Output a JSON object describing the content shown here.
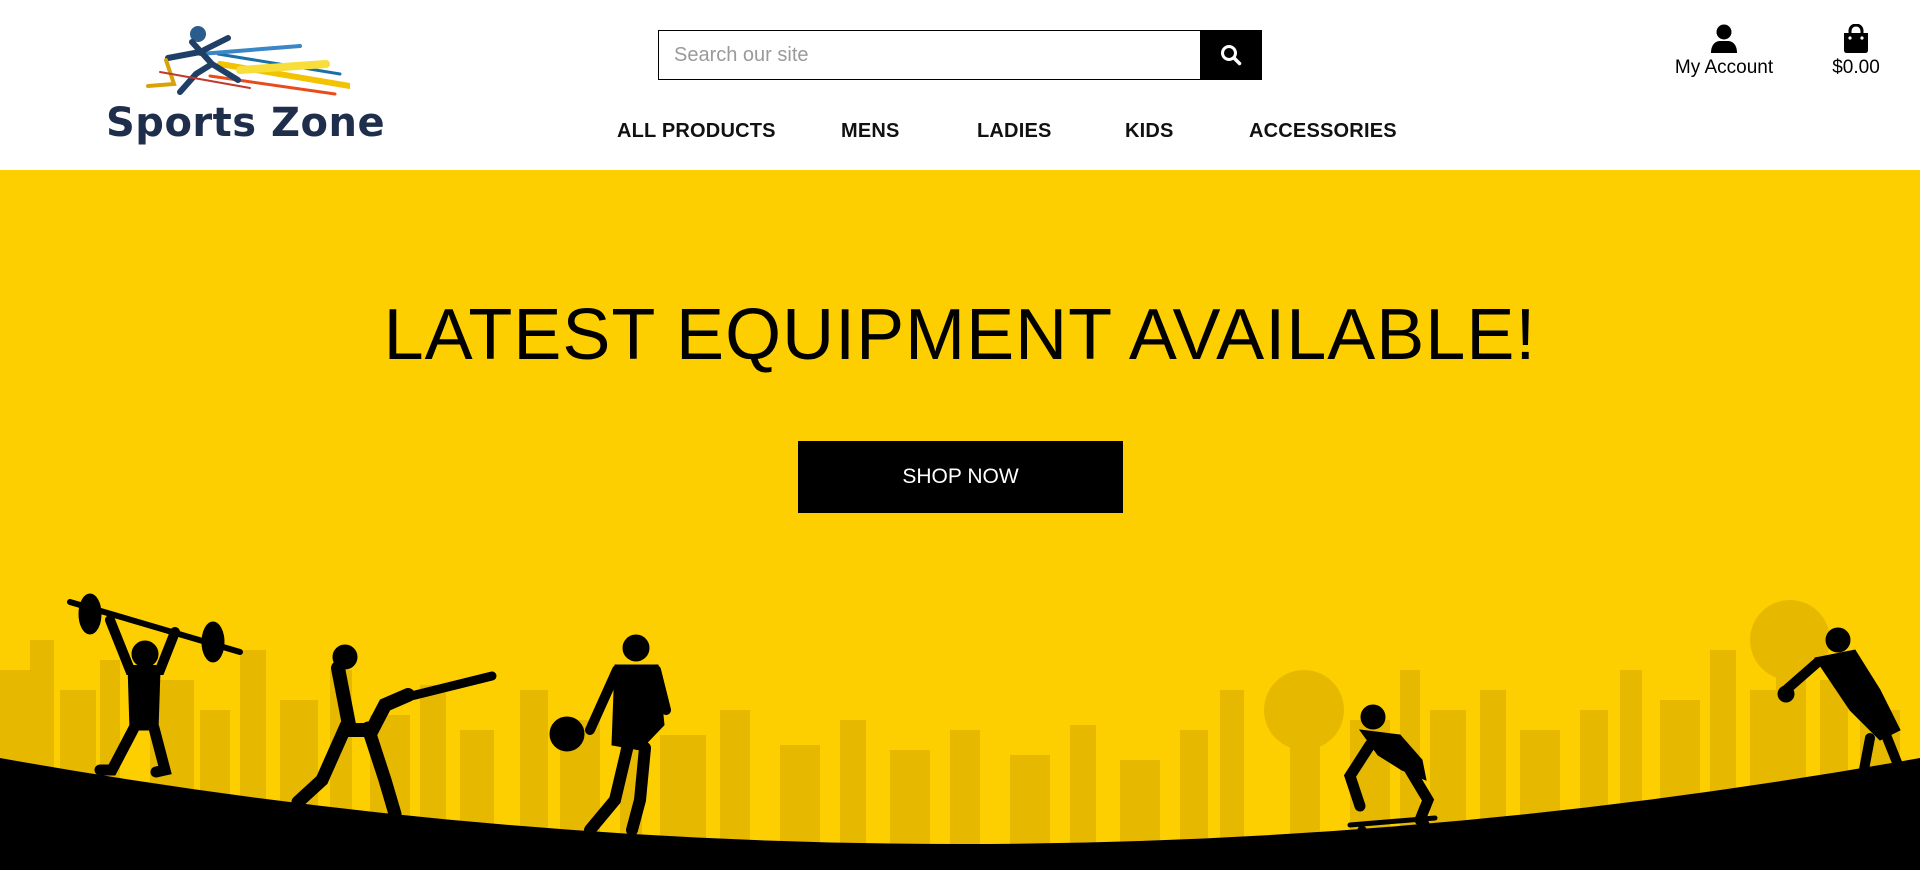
{
  "brand": {
    "name": "Sports Zone",
    "colors": {
      "accent": "#fdcf00",
      "text": "#000000",
      "logo_text": "#1f2e4a"
    }
  },
  "search": {
    "placeholder": "Search our site",
    "value": "",
    "button_icon": "search-icon"
  },
  "account": {
    "label": "My Account",
    "icon": "user-icon"
  },
  "bag": {
    "total": "$0.00",
    "icon": "shopping-bag-icon"
  },
  "nav": {
    "items": [
      {
        "label": "ALL PRODUCTS"
      },
      {
        "label": "MENS"
      },
      {
        "label": "LADIES"
      },
      {
        "label": "KIDS"
      },
      {
        "label": "ACCESSORIES"
      }
    ]
  },
  "hero": {
    "title": "LATEST EQUIPMENT AVAILABLE!",
    "cta_label": "SHOP NOW",
    "background_color": "#fdcf00"
  }
}
